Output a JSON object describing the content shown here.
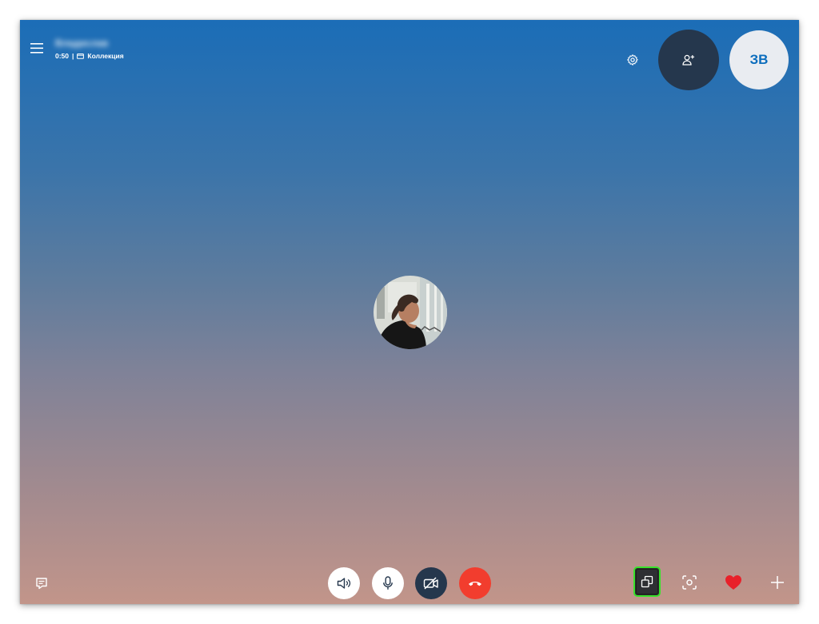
{
  "header": {
    "contact_name": "Владислав",
    "call_duration": "0:50",
    "separator": "|",
    "collection_label": "Коллекция"
  },
  "self_avatar": {
    "initials": "ЗВ"
  },
  "icons": {
    "menu": "hamburger-menu-icon",
    "settings": "gear-icon",
    "add_person": "add-person-icon",
    "chat": "chat-icon",
    "speaker": "speaker-icon",
    "mic": "microphone-icon",
    "video_off": "video-off-icon",
    "hangup": "hang-up-icon",
    "share_screen": "share-screen-icon",
    "snapshot": "snapshot-icon",
    "reaction": "heart-icon",
    "more": "plus-icon"
  },
  "colors": {
    "gradient_top": "#1b6db7",
    "gradient_bottom": "#c2958a",
    "dark_button": "#25374d",
    "hangup": "#f23d2e",
    "highlight": "#38e22b",
    "heart": "#e8212a",
    "initials": "#0b6dbd"
  }
}
